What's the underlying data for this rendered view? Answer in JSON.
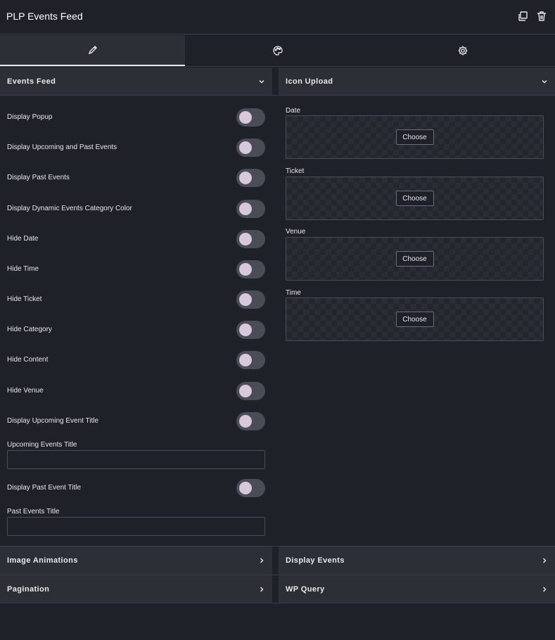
{
  "header": {
    "title": "PLP Events Feed"
  },
  "tabs": [
    {
      "name": "content",
      "icon": "pencil-icon"
    },
    {
      "name": "style",
      "icon": "palette-icon"
    },
    {
      "name": "advanced",
      "icon": "gear-icon"
    }
  ],
  "events_feed": {
    "title": "Events Feed",
    "toggles": [
      {
        "label": "Display Popup",
        "on": false
      },
      {
        "label": "Display Upcoming and Past Events",
        "on": false
      },
      {
        "label": "Display Past Events",
        "on": false
      },
      {
        "label": "Display Dynamic Events Category Color",
        "on": false
      },
      {
        "label": "Hide Date",
        "on": false
      },
      {
        "label": "Hide Time",
        "on": false
      },
      {
        "label": "Hide Ticket",
        "on": false
      },
      {
        "label": "Hide Category",
        "on": false
      },
      {
        "label": "Hide Content",
        "on": false
      },
      {
        "label": "Hide Venue",
        "on": false
      },
      {
        "label": "Display Upcoming Event Title",
        "on": false
      }
    ],
    "upcoming_title_label": "Upcoming Events Title",
    "upcoming_title_value": "",
    "past_title_toggle": {
      "label": "Display Past Event Title",
      "on": false
    },
    "past_title_label": "Past Events Title",
    "past_title_value": ""
  },
  "icon_upload": {
    "title": "Icon Upload",
    "items": [
      {
        "label": "Date",
        "button": "Choose"
      },
      {
        "label": "Ticket",
        "button": "Choose"
      },
      {
        "label": "Venue",
        "button": "Choose"
      },
      {
        "label": "Time",
        "button": "Choose"
      }
    ]
  },
  "collapsed_sections": {
    "image_animations": "Image Animations",
    "display_events": "Display Events",
    "pagination": "Pagination",
    "wp_query": "WP Query"
  }
}
